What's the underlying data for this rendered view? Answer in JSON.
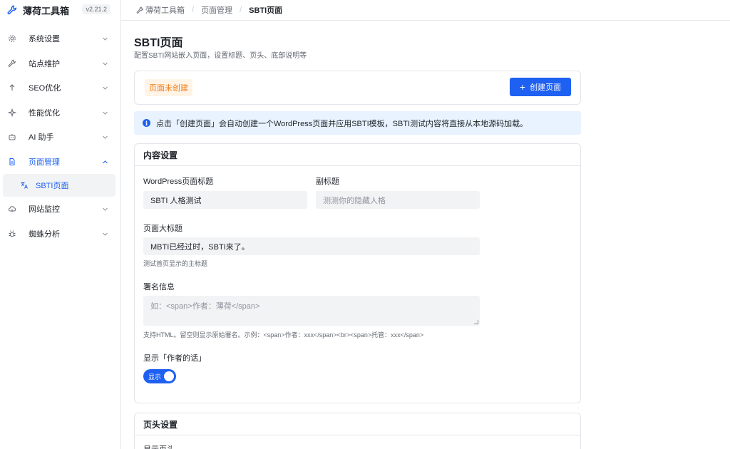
{
  "app": {
    "name": "薄荷工具箱",
    "version": "v2.21.2",
    "brand_color": "#1e60f2"
  },
  "sidebar": {
    "items": [
      {
        "label": "系统设置",
        "icon": "gear-icon"
      },
      {
        "label": "站点维护",
        "icon": "wrench-icon"
      },
      {
        "label": "SEO优化",
        "icon": "arrow-up-icon"
      },
      {
        "label": "性能优化",
        "icon": "sparkle-icon"
      },
      {
        "label": "AI 助手",
        "icon": "robot-icon"
      },
      {
        "label": "页面管理",
        "icon": "document-icon",
        "expanded": true
      },
      {
        "label": "网站监控",
        "icon": "cloud-icon"
      },
      {
        "label": "蜘蛛分析",
        "icon": "bug-icon"
      }
    ],
    "sub_items": [
      {
        "label": "SBTI页面",
        "icon": "translate-icon",
        "active": true
      }
    ]
  },
  "breadcrumb": {
    "home": "薄荷工具箱",
    "section": "页面管理",
    "current": "SBTI页面"
  },
  "page": {
    "title": "SBTI页面",
    "description": "配置SBTI网站嵌入页面，设置标题、页头、底部说明等"
  },
  "status": {
    "tag": "页面未创建",
    "tag_color": "#f07c14",
    "create_button": "创建页面"
  },
  "info": {
    "text": "点击「创建页面」会自动创建一个WordPress页面并应用SBTI模板，SBTI测试内容将直接从本地源码加载。"
  },
  "content_settings": {
    "title": "内容设置",
    "wp_title_label": "WordPress页面标题",
    "wp_title_value": "SBTI 人格测试",
    "subtitle_label": "副标题",
    "subtitle_placeholder": "测测你的隐藏人格",
    "main_title_label": "页面大标题",
    "main_title_value": "MBTI已经过时，SBTI来了。",
    "main_title_help": "测试首页显示的主标题",
    "signature_label": "署名信息",
    "signature_placeholder": "如：<span>作者：薄荷</span>",
    "signature_help": "支持HTML。留空则显示原始署名。示例：<span>作者：xxx</span><br><span>托管：xxx</span>",
    "author_note_label": "显示「作者的话」",
    "author_note_switch_text": "显示",
    "author_note_enabled": true
  },
  "header_settings": {
    "title": "页头设置",
    "first_label": "显示页头"
  }
}
